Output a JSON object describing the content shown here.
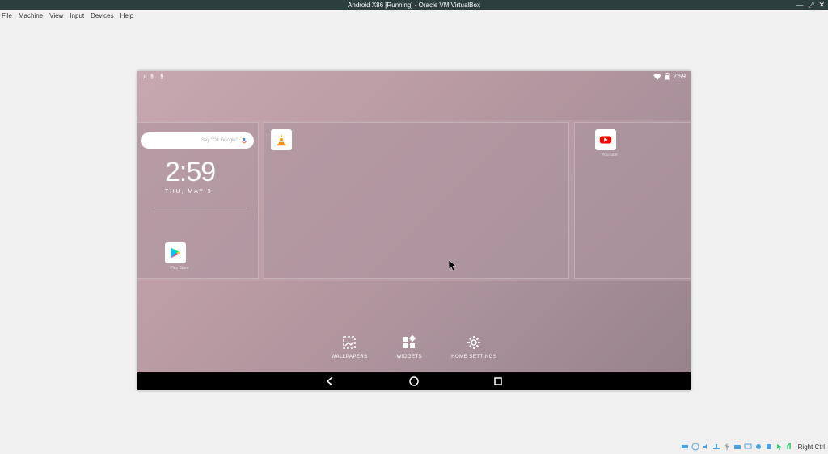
{
  "window": {
    "title": "Android X86 [Running] - Oracle VM VirtualBox",
    "menu": [
      "File",
      "Machine",
      "View",
      "Input",
      "Devices",
      "Help"
    ]
  },
  "statusbar": {
    "host_key": "Right Ctrl"
  },
  "android": {
    "status": {
      "time": "2:59"
    },
    "clock": {
      "time": "2:59",
      "date": "THU, MAY 9"
    },
    "search": {
      "placeholder": "Say \"Ok Google\""
    },
    "apps": {
      "play": {
        "label": "Play Store"
      },
      "vlc": {
        "label": ""
      },
      "youtube": {
        "label": "YouTube"
      }
    },
    "actions": {
      "wallpapers": "WALLPAPERS",
      "widgets": "WIDGETS",
      "home_settings": "HOME SETTINGS"
    }
  }
}
